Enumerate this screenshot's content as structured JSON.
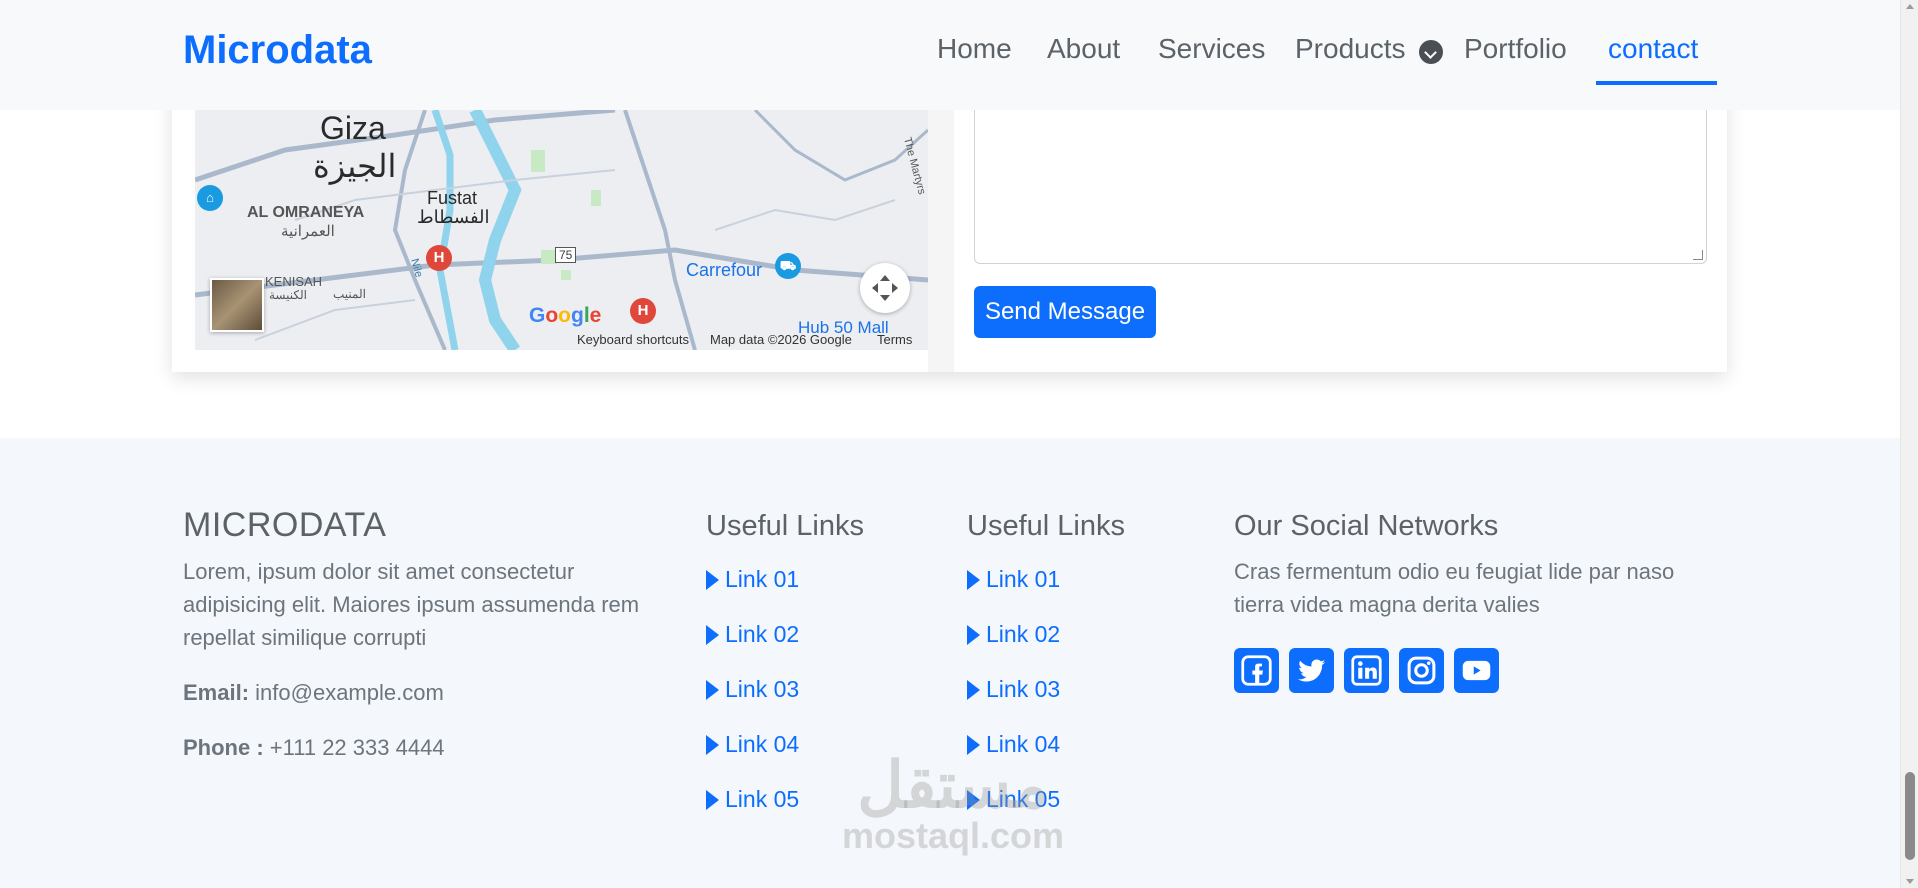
{
  "header": {
    "brand": "Microdata",
    "nav": [
      {
        "label": "Home"
      },
      {
        "label": "About"
      },
      {
        "label": "Services"
      },
      {
        "label": "Products"
      },
      {
        "label": "Portfolio"
      },
      {
        "label": "contact",
        "active": true
      }
    ]
  },
  "map": {
    "labels": {
      "giza_en": "Giza",
      "giza_ar": "الجيزة",
      "al_omraneya_en": "AL OMRANEYA",
      "al_omraneya_ar": "العمرانية",
      "fustat_en": "Fustat",
      "fustat_ar": "الفسطاط",
      "kenisah_en": "KENISAH",
      "kenisah_ar": "الكنيسة",
      "al_monib_ar": "المنيب",
      "carrefour": "Carrefour",
      "hub50": "Hub 50 Mall",
      "road_75": "75",
      "nile": "Nile",
      "marty": "The Martyrs"
    },
    "google_logo": "Google",
    "footer": {
      "shortcuts": "Keyboard shortcuts",
      "data": "Map data ©2026 Google",
      "terms": "Terms"
    }
  },
  "form": {
    "send_label": "Send Message"
  },
  "footer": {
    "brand": "MICRODATA",
    "about_text": "Lorem, ipsum dolor sit amet consectetur adipisicing elit. Maiores ipsum assumenda rem repellat similique corrupti",
    "email_label": "Email:",
    "email_value": "info@example.com",
    "phone_label": "Phone :",
    "phone_value": "+111 22 333 4444",
    "links_col1": {
      "title": "Useful Links",
      "links": [
        "Link 01",
        "Link 02",
        "Link 03",
        "Link 04",
        "Link 05"
      ]
    },
    "links_col2": {
      "title": "Useful Links",
      "links": [
        "Link 01",
        "Link 02",
        "Link 03",
        "Link 04",
        "Link 05"
      ]
    },
    "social": {
      "title": "Our Social Networks",
      "text": "Cras fermentum odio eu feugiat lide par naso tierra videa magna derita valies",
      "networks": [
        "facebook-icon",
        "twitter-icon",
        "linkedin-icon",
        "instagram-icon",
        "youtube-icon"
      ]
    }
  },
  "watermark": {
    "arabic": "مستقل",
    "latin": "mostaql.com"
  },
  "colors": {
    "primary": "#0d6efd",
    "header_bg": "#f8f9fa",
    "footer_bg": "#f4f7fb",
    "text_muted": "#6c757d"
  }
}
